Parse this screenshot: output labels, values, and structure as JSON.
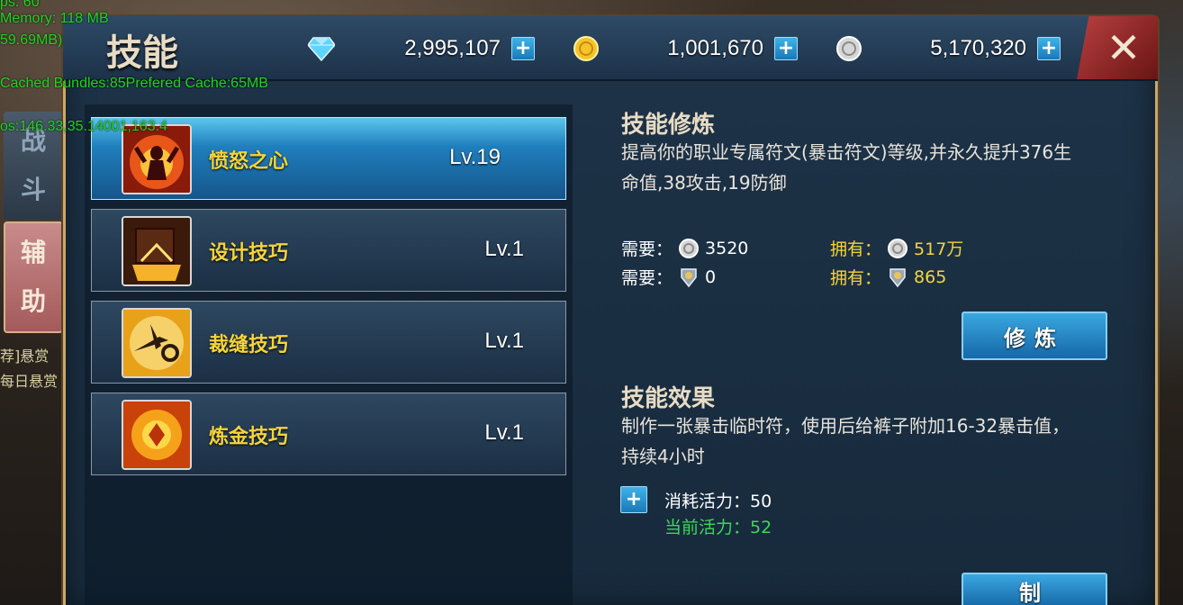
{
  "debug": {
    "line1": "ps: 60",
    "line2": "Memory: 118 MB",
    "line3": "59.69MB)",
    "line4": "Cached Bundles:85Prefered Cache:65MB",
    "line5": "os:146.33,35.14001,163.4"
  },
  "side_tabs": {
    "fight": [
      "战",
      "斗"
    ],
    "assist": [
      "辅",
      "助"
    ],
    "bounty1": "荐]悬赏",
    "bounty2": "每日悬赏"
  },
  "header": {
    "title": "技能",
    "close_label": "✕"
  },
  "currencies": [
    {
      "icon": "diamond-icon",
      "value": "2,995,107"
    },
    {
      "icon": "gold-coin-icon",
      "value": "1,001,670"
    },
    {
      "icon": "silver-coin-icon",
      "value": "5,170,320"
    }
  ],
  "skills": [
    {
      "name": "愤怒之心",
      "level": "Lv.19",
      "icon": "rage-heart-icon",
      "active": true
    },
    {
      "name": "设计技巧",
      "level": "Lv.1",
      "icon": "design-skill-icon",
      "active": false
    },
    {
      "name": "裁缝技巧",
      "level": "Lv.1",
      "icon": "tailoring-skill-icon",
      "active": false
    },
    {
      "name": "炼金技巧",
      "level": "Lv.1",
      "icon": "alchemy-skill-icon",
      "active": false
    }
  ],
  "training": {
    "title": "技能修炼",
    "desc": "提高你的职业专属符文(暴击符文)等级,并永久提升376生命值,38攻击,19防御",
    "need_label": "需要：",
    "own_label": "拥有：",
    "req1_value": "3520",
    "req2_value": "0",
    "own1_value": "517万",
    "own2_value": "865",
    "button": "修炼"
  },
  "effect": {
    "title": "技能效果",
    "desc": "制作一张暴击临时符，使用后给裤子附加16-32暴击值，持续4小时",
    "cost_label": "消耗活力：50",
    "current_label": "当前活力：52",
    "button": "制"
  },
  "colors": {
    "accent_gold": "#f5d43a",
    "accent_green": "#3fd65a",
    "button_blue": "#1f7fbd"
  }
}
